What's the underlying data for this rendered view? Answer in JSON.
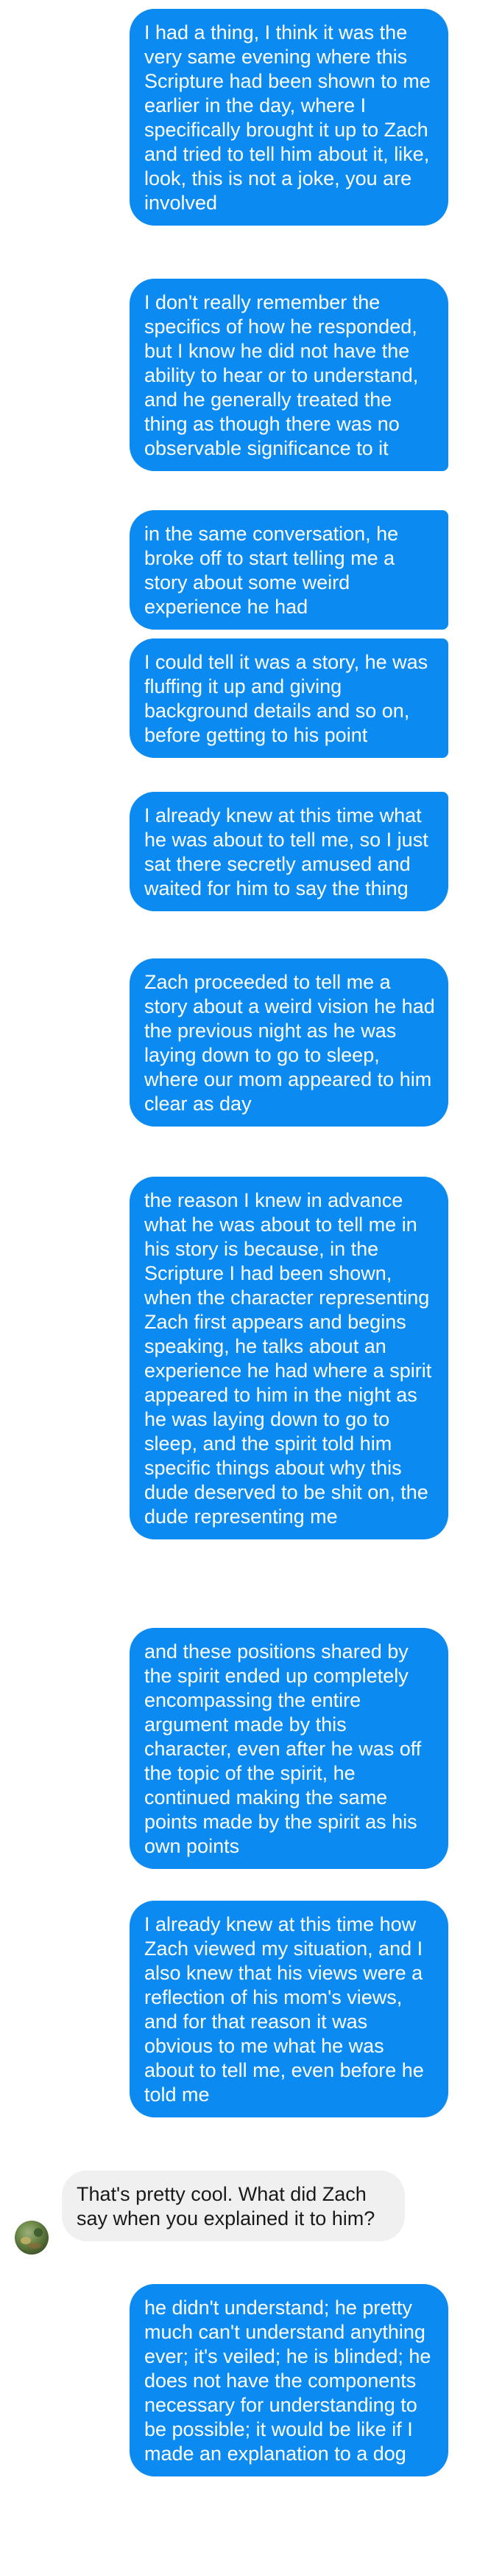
{
  "messages": [
    {
      "sender": "me",
      "text": "I had a thing, I think it was the very same evening where this Scripture had been shown to me earlier in the day, where I specifically brought it up to Zach and tried to tell him about it, like, look, this is not a joke, you are involved"
    },
    {
      "sender": "me",
      "text": "I don't really remember the specifics of how he responded, but I know he did not have the ability to hear or to understand, and he generally treated the thing as though there was no observable significance to it"
    },
    {
      "sender": "me",
      "text": "in the same conversation, he broke off to start telling me a story about some weird experience he had"
    },
    {
      "sender": "me",
      "text": "I could tell it was a story, he was fluffing it up and giving background details and so on, before getting to his point"
    },
    {
      "sender": "me",
      "text": "I already knew at this time what he was about to tell me, so I just sat there secretly amused and waited for him to say the thing"
    },
    {
      "sender": "me",
      "text": "Zach proceeded to tell me a story about a weird vision he had the previous night as he was laying down to go to sleep, where our mom appeared to him clear as day"
    },
    {
      "sender": "me",
      "text": "the reason I knew in advance what he was about to tell me in his story is because, in the Scripture I had been shown, when the character representing Zach first appears and begins speaking, he talks about an experience he had where a spirit appeared to him in the night as he was laying down to go to sleep, and the spirit told him specific things about why this dude deserved to be shit on, the dude representing me"
    },
    {
      "sender": "me",
      "text": "and these positions shared by the spirit ended up completely encompassing the entire argument made by this character, even after he was off the topic of the spirit, he continued making the same points made by the spirit as his own points"
    },
    {
      "sender": "me",
      "text": "I already knew at this time how Zach viewed my situation, and I also knew that his views were a reflection of his mom's views, and for that reason it was obvious to me what he was about to tell me, even before he told me"
    },
    {
      "sender": "other",
      "text": "That's pretty cool. What did Zach say when you explained it to him?"
    },
    {
      "sender": "me",
      "text": "he didn't understand; he pretty much can't understand anything ever; it's veiled; he is blinded; he does not have the components necessary for understanding to be possible; it would be like if I made an explanation to a dog"
    }
  ],
  "colors": {
    "sent_bubble": "#0b8bf2",
    "received_bubble": "#f0f0f0"
  },
  "icons": {
    "avatar": "contact-avatar"
  }
}
